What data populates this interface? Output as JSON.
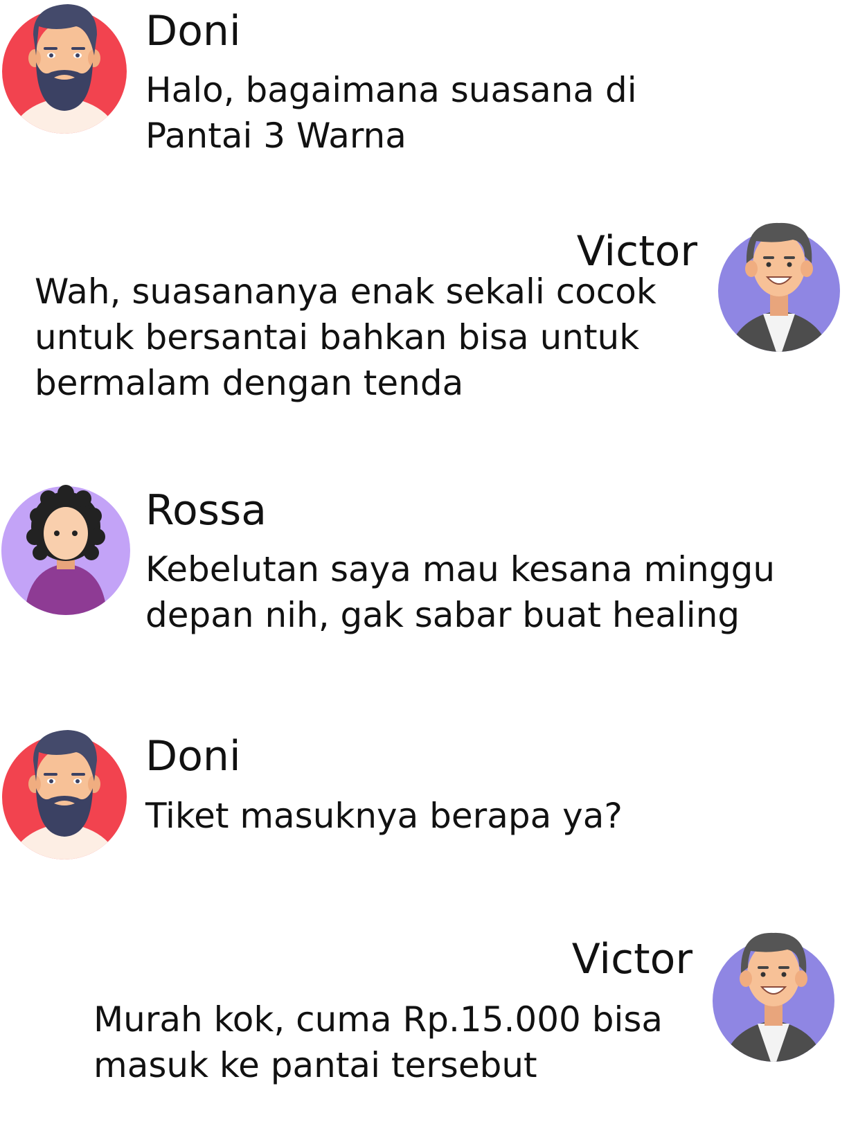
{
  "chat": {
    "messages": [
      {
        "sender": "Doni",
        "avatar": "bearded-man-avatar-icon",
        "lines": [
          "Halo, bagaimana suasana di",
          "Pantai 3 Warna"
        ]
      },
      {
        "sender": "Victor",
        "avatar": "young-man-avatar-icon",
        "lines": [
          "Wah, suasananya enak sekali cocok",
          "untuk bersantai bahkan bisa untuk",
          "bermalam dengan tenda"
        ]
      },
      {
        "sender": "Rossa",
        "avatar": "curly-hair-woman-avatar-icon",
        "lines": [
          "Kebelutan saya mau kesana minggu",
          "depan nih, gak sabar buat healing"
        ]
      },
      {
        "sender": "Doni",
        "avatar": "bearded-man-avatar-icon",
        "lines": [
          "Tiket masuknya berapa ya?"
        ]
      },
      {
        "sender": "Victor",
        "avatar": "young-man-avatar-icon",
        "lines": [
          "Murah kok, cuma Rp.15.000 bisa",
          "masuk ke pantai tersebut"
        ]
      }
    ]
  },
  "colors": {
    "doni_avatar_bg": "#f2434f",
    "victor_avatar_bg": "#8f86e3",
    "rossa_avatar_bg": "#c3a3f7",
    "rossa_shirt": "#8e3b94",
    "skin": "#f7c197",
    "hair_dark": "#444a6b",
    "hair_grey": "#555555"
  }
}
